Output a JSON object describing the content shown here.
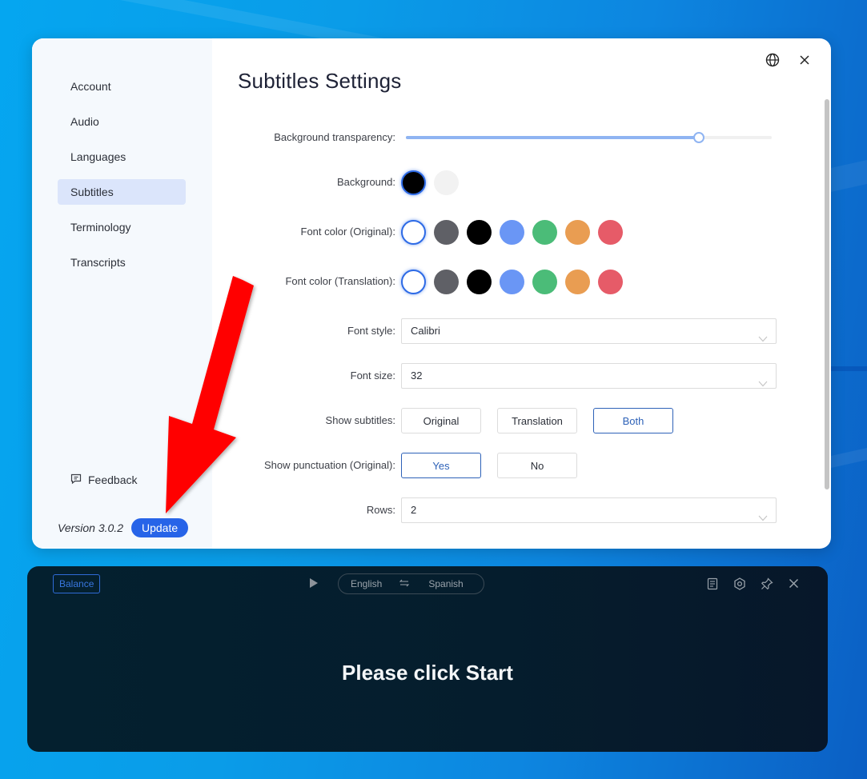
{
  "settings": {
    "title": "Subtitles Settings",
    "sidebar": {
      "items": [
        {
          "label": "Account",
          "active": false
        },
        {
          "label": "Audio",
          "active": false
        },
        {
          "label": "Languages",
          "active": false
        },
        {
          "label": "Subtitles",
          "active": true
        },
        {
          "label": "Terminology",
          "active": false
        },
        {
          "label": "Transcripts",
          "active": false
        }
      ],
      "feedback_label": "Feedback",
      "version": "Version 3.0.2",
      "update_label": "Update"
    },
    "form": {
      "transparency": {
        "label": "Background transparency",
        "value_percent": 80
      },
      "background": {
        "label": "Background",
        "colors": [
          "#000000",
          "#f2f2f2"
        ],
        "selected": 0
      },
      "font_color_original": {
        "label": "Font color (Original)",
        "colors": [
          "#ffffff",
          "#5f6066",
          "#000000",
          "#6a96f5",
          "#4bbc78",
          "#e99d52",
          "#e65b68"
        ],
        "selected": 0
      },
      "font_color_translation": {
        "label": "Font color (Translation)",
        "colors": [
          "#ffffff",
          "#5f6066",
          "#000000",
          "#6a96f5",
          "#4bbc78",
          "#e99d52",
          "#e65b68"
        ],
        "selected": 0
      },
      "font_style": {
        "label": "Font style",
        "value": "Calibri"
      },
      "font_size": {
        "label": "Font size",
        "value": "32"
      },
      "show_subtitles": {
        "label": "Show subtitles",
        "options": [
          "Original",
          "Translation",
          "Both"
        ],
        "selected": 2
      },
      "show_punctuation": {
        "label": "Show punctuation (Original)",
        "options": [
          "Yes",
          "No"
        ],
        "selected": 0
      },
      "rows": {
        "label": "Rows",
        "value": "2"
      }
    },
    "label_suffix": ":"
  },
  "subtitle_bar": {
    "balance_label": "Balance",
    "source_language": "English",
    "target_language": "Spanish",
    "message": "Please click Start"
  },
  "colors": {
    "accent": "#2764e8",
    "annotation_arrow": "#ff0000"
  }
}
